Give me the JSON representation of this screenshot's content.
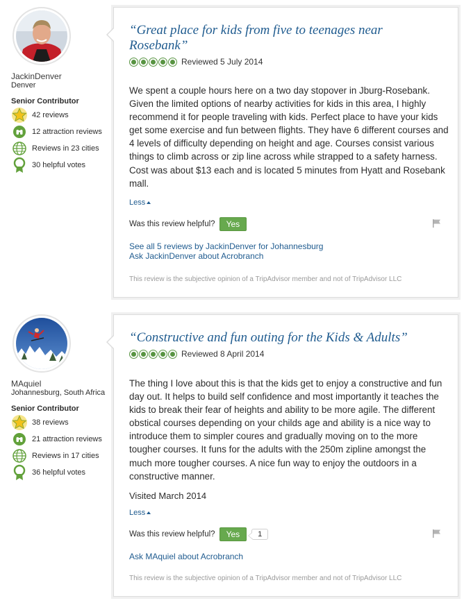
{
  "reviews": [
    {
      "member": {
        "username": "JackinDenver",
        "location": "Denver",
        "badge": "Senior Contributor",
        "stats": {
          "reviews": "42 reviews",
          "attraction_reviews": "12 attraction reviews",
          "cities": "Reviews in 23 cities",
          "helpful_votes": "30 helpful votes"
        }
      },
      "title": "“Great place for kids from five to teenages near Rosebank”",
      "rating": 5,
      "reviewed_date": "Reviewed 5 July 2014",
      "body": "We spent a couple hours here on a two day stopover in Jburg-Rosebank. Given the limited options of nearby activities for kids in this area, I highly recommend it for people traveling with kids. Perfect place to have your kids get some exercise and fun between flights. They have 6 different courses and 4 levels of difficulty depending on height and age. Courses consist various things to climb across or zip line across while strapped to a safety harness. Cost was about $13 each and is located 5 minutes from Hyatt and Rosebank mall.",
      "less_label": "Less",
      "helpful_question": "Was this review helpful?",
      "yes_label": "Yes",
      "links": [
        "See all 5 reviews by JackinDenver for Johannesburg",
        "Ask JackinDenver about Acrobranch"
      ],
      "disclaimer": "This review is the subjective opinion of a TripAdvisor member and not of TripAdvisor LLC"
    },
    {
      "member": {
        "username": "MAquiel",
        "location": "Johannesburg, South Africa",
        "badge": "Senior Contributor",
        "stats": {
          "reviews": "38 reviews",
          "attraction_reviews": "21 attraction reviews",
          "cities": "Reviews in 17 cities",
          "helpful_votes": "36 helpful votes"
        }
      },
      "title": "“Constructive and fun outing for the Kids & Adults”",
      "rating": 5,
      "reviewed_date": "Reviewed 8 April 2014",
      "body": "The thing I love about this is that the kids get to enjoy a constructive and fun day out. It helps to build self confidence and most importantly it teaches the kids to break their fear of heights and ability to be more agile. The different obstical courses depending on your childs age and ability is a nice way to introduce them to simpler coures and gradually moving on to the more tougher courses. It funs for the adults with the 250m zipline amongst the much more tougher courses. A nice fun way to enjoy the outdoors in a constructive manner.",
      "visited": "Visited March 2014",
      "less_label": "Less",
      "helpful_question": "Was this review helpful?",
      "yes_label": "Yes",
      "vote_count": "1",
      "links": [
        "Ask MAquiel about Acrobranch"
      ],
      "disclaimer": "This review is the subjective opinion of a TripAdvisor member and not of TripAdvisor LLC"
    }
  ],
  "colors": {
    "link": "#1f5b8f",
    "rating_green": "#589442",
    "yes_button": "#67a94e",
    "badge_gold": "#f2c21a",
    "icon_green": "#62a13b"
  }
}
